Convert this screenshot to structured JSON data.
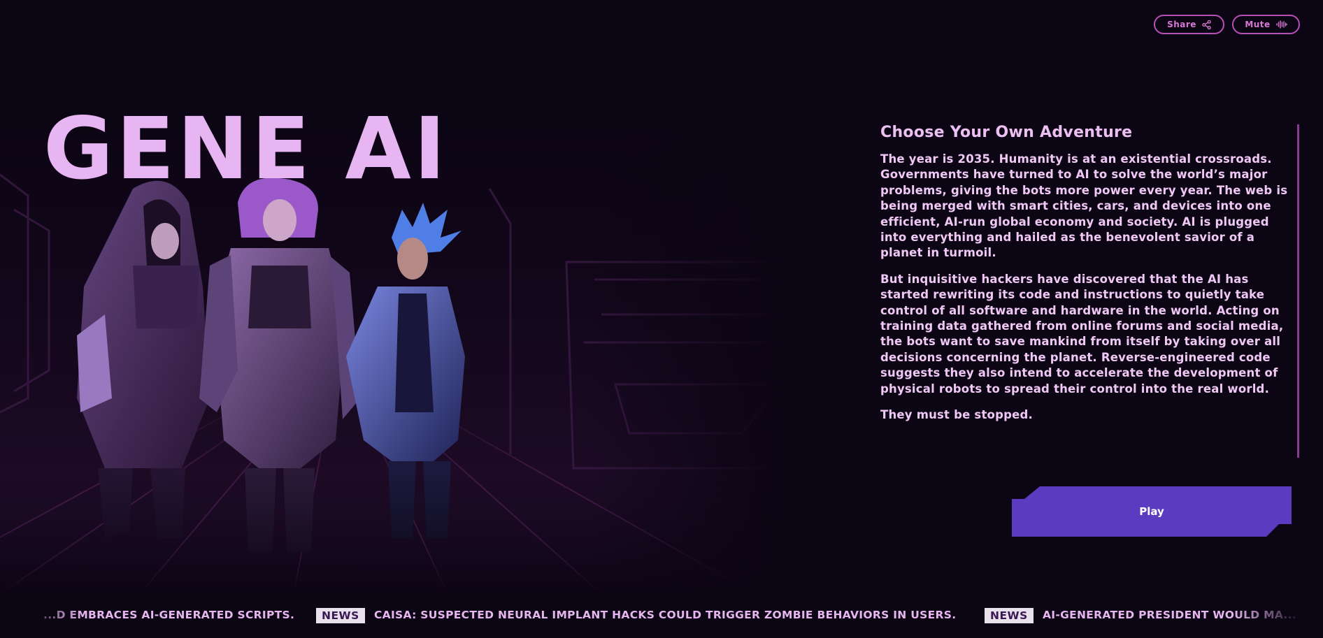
{
  "header": {
    "share_label": "Share",
    "mute_label": "Mute",
    "share_icon": "share-icon",
    "mute_icon": "sound-wave-icon"
  },
  "hero": {
    "title": "GENE AI",
    "art": "cyberpunk-characters-illustration"
  },
  "story": {
    "heading": "Choose Your Own Adventure",
    "paragraphs": [
      "The year is 2035. Humanity is at an existential crossroads. Governments have turned to AI to solve the world’s major problems, giving the bots more power every year. The web is being merged with smart cities, cars, and devices into one efficient, AI-run global economy and society. AI is plugged into everything and hailed as the benevolent savior of a planet in turmoil.",
      "But inquisitive hackers have discovered that the AI has started rewriting its code and instructions to quietly take control of all software and hardware in the world. Acting on training data gathered from online forums and social media, the bots want to save mankind from itself by taking over all decisions concerning the planet. Reverse-engineered code suggests they also intend to accelerate the development of physical robots to spread their control into the real world.",
      "They must be stopped."
    ]
  },
  "play_label": "Play",
  "ticker": {
    "badge": "NEWS",
    "items": [
      "...D EMBRACES AI-GENERATED SCRIPTS.",
      "CAISA: SUSPECTED NEURAL IMPLANT HACKS COULD TRIGGER ZOMBIE BEHAVIORS IN USERS.",
      "AI-GENERATED PRESIDENT WOULD MA..."
    ]
  },
  "colors": {
    "background": "#0c0514",
    "accent_pink": "#e8b5f3",
    "button_purple": "#5b3bbf",
    "outline_pink": "#b84fb7"
  }
}
